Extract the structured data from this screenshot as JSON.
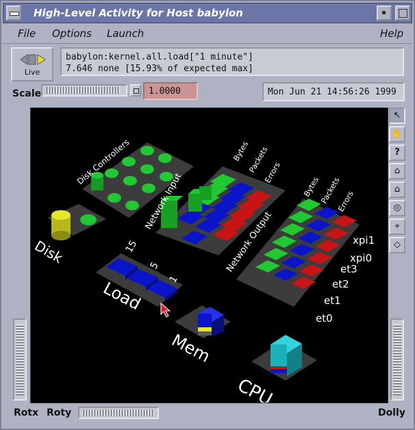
{
  "window": {
    "title": "High-Level Activity for Host babylon"
  },
  "menu": {
    "file": "File",
    "options": "Options",
    "launch": "Launch",
    "help": "Help"
  },
  "live": {
    "label": "Live"
  },
  "info": {
    "line1": "babylon:kernel.all.load[\"1 minute\"]",
    "line2": "7.646 none [15.93% of expected max]"
  },
  "scale": {
    "label": "Scale",
    "value": "1.0000"
  },
  "date": "Mon Jun 21 14:56:26 1999",
  "scene": {
    "disk_label": "Disk",
    "disk_controllers_label": "Disk Controllers",
    "load_label": "Load",
    "load_ticks": [
      "15",
      "5",
      "1"
    ],
    "mem_label": "Mem",
    "cpu_label": "CPU",
    "network_input_label": "Network Input",
    "network_output_label": "Network Output",
    "net_columns": [
      "Bytes",
      "Packets",
      "Errors"
    ],
    "interfaces": [
      "xpi1",
      "xpi0",
      "et3",
      "et2",
      "et1",
      "et0"
    ]
  },
  "tools": [
    "pointer-icon",
    "hand-icon",
    "help-icon",
    "home-icon",
    "set-home-icon",
    "view-all-icon",
    "seek-icon",
    "perspective-icon"
  ],
  "bottom": {
    "rotx": "Rotx",
    "roty": "Roty",
    "dolly": "Dolly"
  },
  "colors": {
    "green": "#22c832",
    "blue": "#0a14c8",
    "red": "#c81414",
    "yellow": "#e6e62a",
    "cyan": "#1cb0b8",
    "titlebar": "#6b76a7"
  }
}
